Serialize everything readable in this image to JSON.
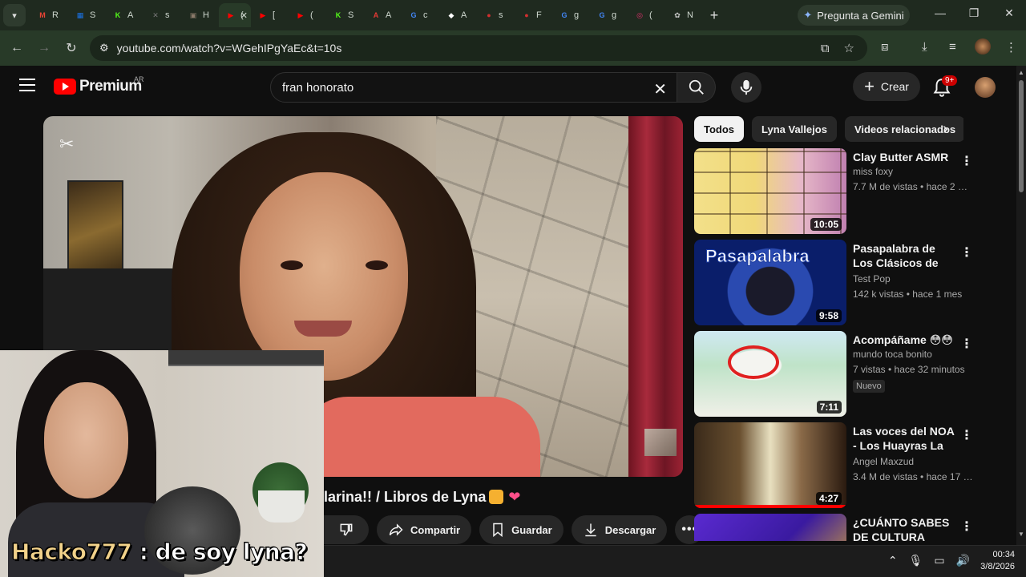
{
  "browser": {
    "tabs": [
      {
        "icon": "gmail-icon",
        "letter": "M",
        "label": "R",
        "color": "#ea4335"
      },
      {
        "icon": "grid-app-icon",
        "letter": "▦",
        "label": "S",
        "color": "#1a73e8"
      },
      {
        "icon": "kick-icon",
        "letter": "K",
        "label": "A",
        "color": "#53fc18"
      },
      {
        "icon": "x-box-icon",
        "letter": "✕",
        "label": "s",
        "color": "#777777"
      },
      {
        "icon": "image-icon",
        "letter": "▣",
        "label": "H",
        "color": "#8a7a6a"
      },
      {
        "icon": "youtube-icon",
        "letter": "▶",
        "label": "(",
        "color": "#ff0000"
      },
      {
        "icon": "youtube-icon",
        "letter": "▶",
        "label": "[",
        "color": "#ff0000"
      },
      {
        "icon": "youtube-icon",
        "letter": "▶",
        "label": "(",
        "color": "#ff0000"
      },
      {
        "icon": "kick-icon",
        "letter": "K",
        "label": "S",
        "color": "#53fc18"
      },
      {
        "icon": "pdf-icon",
        "letter": "A",
        "label": "A",
        "color": "#e53935"
      },
      {
        "icon": "google-icon",
        "letter": "G",
        "label": "c",
        "color": "#4285f4"
      },
      {
        "icon": "diamond-icon",
        "letter": "◆",
        "label": "A",
        "color": "#ffffff"
      },
      {
        "icon": "red-dot-icon",
        "letter": "●",
        "label": "s",
        "color": "#d32f2f"
      },
      {
        "icon": "red-dot-icon",
        "letter": "●",
        "label": "F",
        "color": "#d32f2f"
      },
      {
        "icon": "google-icon",
        "letter": "G",
        "label": "g",
        "color": "#4285f4"
      },
      {
        "icon": "google-icon",
        "letter": "G",
        "label": "g",
        "color": "#4285f4"
      },
      {
        "icon": "instagram-icon",
        "letter": "◎",
        "label": "(",
        "color": "#e1306c"
      },
      {
        "icon": "openai-icon",
        "letter": "✿",
        "label": "N",
        "color": "#cccccc"
      }
    ],
    "active_tab_label": "(",
    "gemini_label": "Pregunta a Gemini",
    "url": "youtube.com/watch?v=WGehIPgYaEc&t=10s"
  },
  "youtube": {
    "logo_text": "Premium",
    "region": "AR",
    "search_value": "fran honorato",
    "create_label": "Crear",
    "notif_badge": "9+"
  },
  "player": {
    "overlay_name": "Hacko777",
    "overlay_message": " : de soy lyna?"
  },
  "video": {
    "title": "larina!! / Libros de Lyna",
    "actions": {
      "share": "Compartir",
      "save": "Guardar",
      "download": "Descargar"
    }
  },
  "chips": [
    "Todos",
    "Lyna Vallejos",
    "Videos relacionados"
  ],
  "recommendations": [
    {
      "title": "Clay Butter ASMR",
      "channel": "miss foxy",
      "meta": "7.7 M de vistas • hace 2 me...",
      "duration": "10:05",
      "thumb": "butter",
      "badge": ""
    },
    {
      "title": "Pasapalabra de Los Clásicos de Disney ...",
      "channel": "Test Pop",
      "meta": "142 k vistas • hace 1 mes",
      "duration": "9:58",
      "thumb": "pasapalabra",
      "badge": ""
    },
    {
      "title": "Acompáñame 😳😳",
      "channel": "mundo toca bonito",
      "meta": "7 vistas • hace 32 minutos",
      "duration": "7:11",
      "thumb": "toca",
      "badge": "Nuevo"
    },
    {
      "title": "Las voces del NOA - Los Huayras   La ...",
      "channel": "Angel Maxzud",
      "meta": "3.4 M de vistas • hace 17 a...",
      "duration": "4:27",
      "thumb": "huayras",
      "badge": ""
    },
    {
      "title": "¿CUÁNTO SABES DE CULTURA GENERA...",
      "channel": "",
      "meta": "",
      "duration": "",
      "thumb": "quiz",
      "badge": ""
    }
  ],
  "taskbar": {
    "time": "00:34",
    "date": "3/8/2026"
  }
}
